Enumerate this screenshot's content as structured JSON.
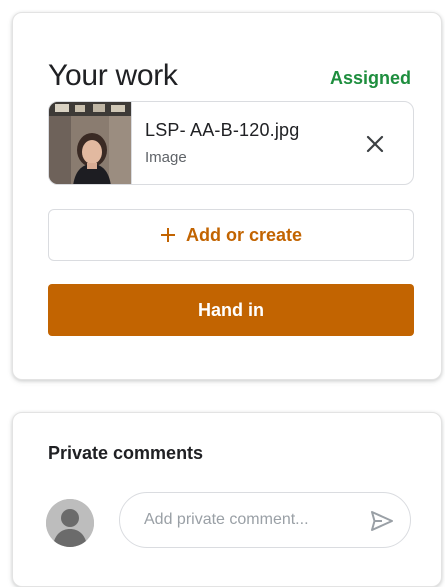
{
  "your_work": {
    "title": "Your work",
    "status": "Assigned",
    "status_color": "#1e8e3e",
    "attachment": {
      "file_name": "LSP- AA-B-120.jpg",
      "file_type": "Image",
      "thumbnail_icon": "photo-thumbnail",
      "remove_icon": "close-icon"
    },
    "add_button": {
      "icon": "plus-icon",
      "label": "Add or create"
    },
    "hand_in_button": {
      "label": "Hand in"
    },
    "accent_color": "#c26401"
  },
  "private_comments": {
    "title": "Private comments",
    "avatar_icon": "avatar-icon",
    "input_placeholder": "Add private comment...",
    "input_value": "",
    "send_icon": "send-icon"
  }
}
